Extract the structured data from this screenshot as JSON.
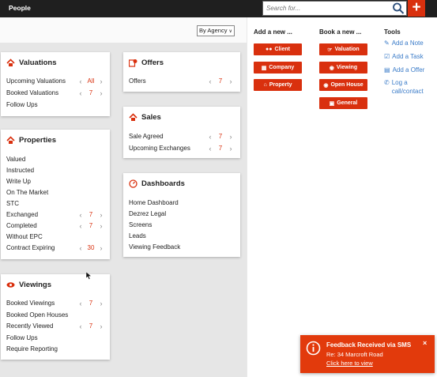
{
  "app": {
    "title": "People"
  },
  "search": {
    "placeholder": "Search for..."
  },
  "add_button": {
    "label": "+"
  },
  "filter": {
    "agency": "By Agency"
  },
  "valuations": {
    "title": "Valuations",
    "rows": [
      {
        "label": "Upcoming Valuations",
        "count": "All"
      },
      {
        "label": "Booked Valuations",
        "count": "7"
      },
      {
        "label": "Follow Ups"
      }
    ]
  },
  "offers": {
    "title": "Offers",
    "rows": [
      {
        "label": "Offers",
        "count": "7"
      }
    ]
  },
  "sales": {
    "title": "Sales",
    "rows": [
      {
        "label": "Sale Agreed",
        "count": "7"
      },
      {
        "label": "Upcoming Exchanges",
        "count": "7"
      }
    ]
  },
  "properties": {
    "title": "Properties",
    "rows": [
      {
        "label": "Valued"
      },
      {
        "label": "Instructed"
      },
      {
        "label": "Write Up"
      },
      {
        "label": "On The Market"
      },
      {
        "label": "STC"
      },
      {
        "label": "Exchanged",
        "count": "7"
      },
      {
        "label": "Completed",
        "count": "7"
      },
      {
        "label": "Without EPC"
      },
      {
        "label": "Contract Expiring",
        "count": "30"
      }
    ]
  },
  "dashboards": {
    "title": "Dashboards",
    "rows": [
      {
        "label": "Home Dashboard"
      },
      {
        "label": "Dezrez Legal"
      },
      {
        "label": "Screens"
      },
      {
        "label": "Leads"
      },
      {
        "label": "Viewing Feedback"
      }
    ]
  },
  "viewings": {
    "title": "Viewings",
    "rows": [
      {
        "label": "Booked Viewings",
        "count": "7"
      },
      {
        "label": "Booked Open Houses"
      },
      {
        "label": "Recently Viewed",
        "count": "7"
      },
      {
        "label": "Follow Ups"
      },
      {
        "label": "Require Reporting"
      }
    ]
  },
  "add_new": {
    "heading": "Add a new ...",
    "buttons": [
      {
        "label": "Client",
        "icon": "people-icon"
      },
      {
        "label": "Company",
        "icon": "building-icon"
      },
      {
        "label": "Property",
        "icon": "home-icon"
      }
    ]
  },
  "book_new": {
    "heading": "Book a new ...",
    "buttons": [
      {
        "label": "Valuation",
        "icon": "handshake-icon"
      },
      {
        "label": "Viewing",
        "icon": "eye-icon"
      },
      {
        "label": "Open House",
        "icon": "eye-icon"
      },
      {
        "label": "General",
        "icon": "calendar-icon"
      }
    ]
  },
  "tools": {
    "heading": "Tools",
    "links": [
      {
        "label": "Add a Note",
        "icon": "pencil-icon"
      },
      {
        "label": "Add a Task",
        "icon": "checkbox-icon"
      },
      {
        "label": "Add a Offer",
        "icon": "offer-icon"
      },
      {
        "label": "Log a call/contact",
        "icon": "phone-icon"
      }
    ]
  },
  "toast": {
    "title": "Feedback Received via SMS",
    "message": "Re: 34 Marcroft Road",
    "link": "Click here to view",
    "close": "×"
  },
  "colors": {
    "accent": "#d9300e",
    "link": "#3a7bc8",
    "topbar": "#1f1f1f"
  }
}
